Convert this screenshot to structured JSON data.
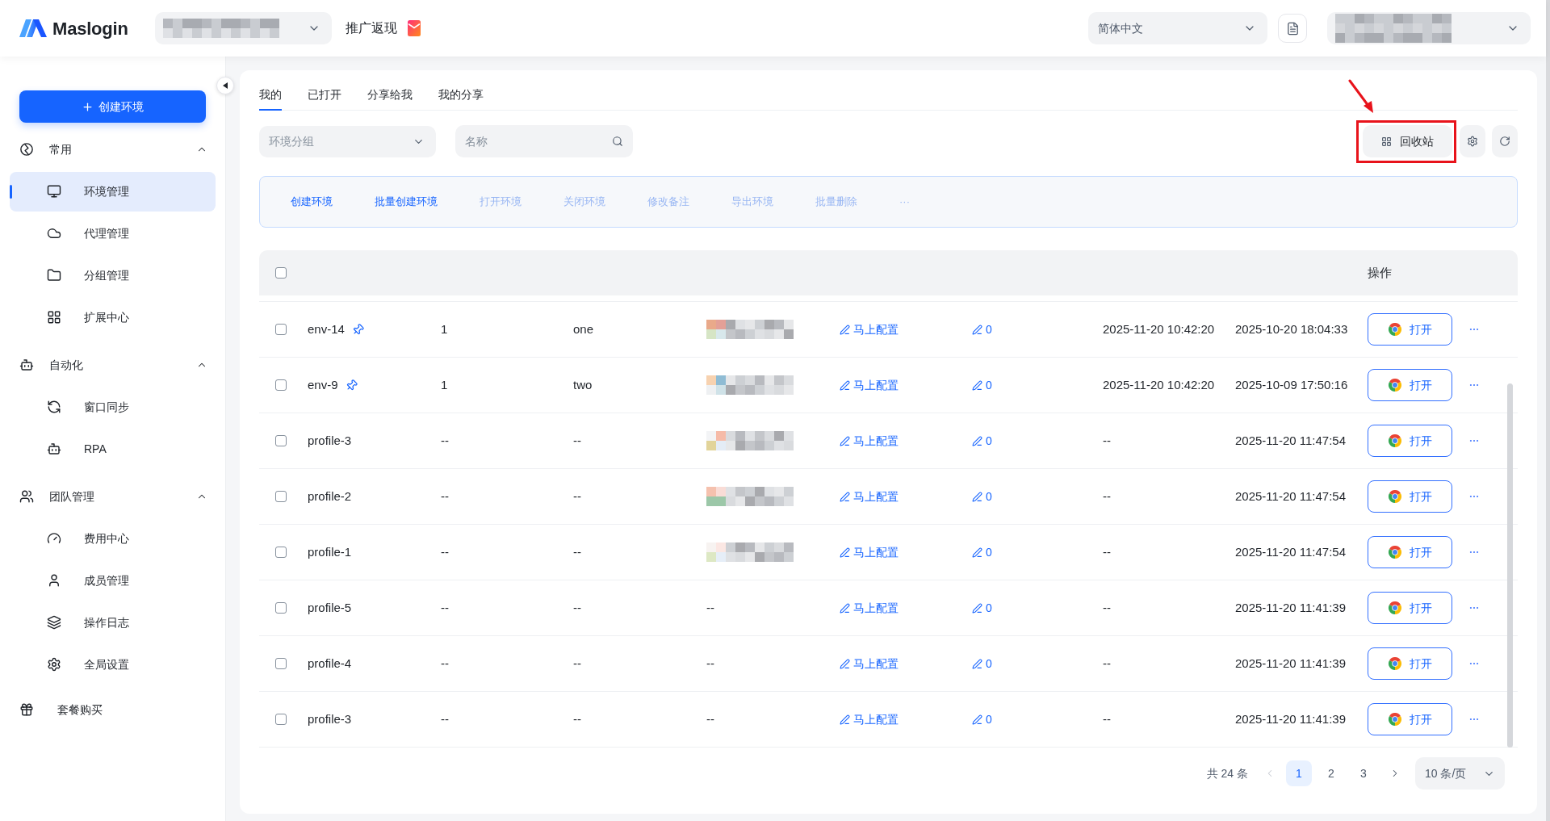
{
  "header": {
    "logo": "Maslogin",
    "workspace_select": {
      "kind": "blurred"
    },
    "promo_link": "推广返现",
    "language_select": {
      "value": "简体中文"
    },
    "account_select": {
      "kind": "blurred"
    }
  },
  "sidebar": {
    "create_button": "创建环境",
    "nav": [
      {
        "kind": "group",
        "label": "常用",
        "expanded": true,
        "children": [
          {
            "label": "环境管理",
            "selected": true
          },
          {
            "label": "代理管理",
            "selected": false
          },
          {
            "label": "分组管理",
            "selected": false
          },
          {
            "label": "扩展中心",
            "selected": false
          }
        ]
      },
      {
        "kind": "group",
        "label": "自动化",
        "expanded": true,
        "children": [
          {
            "label": "窗口同步",
            "selected": false
          },
          {
            "label": "RPA",
            "selected": false
          }
        ]
      },
      {
        "kind": "group",
        "label": "团队管理",
        "expanded": true,
        "children": [
          {
            "label": "费用中心",
            "selected": false
          },
          {
            "label": "成员管理",
            "selected": false
          },
          {
            "label": "操作日志",
            "selected": false
          },
          {
            "label": "全局设置",
            "selected": false
          }
        ]
      },
      {
        "kind": "link",
        "label": "套餐购买",
        "selected": false
      }
    ]
  },
  "tabs": [
    {
      "label": "我的",
      "selected": true
    },
    {
      "label": "已打开",
      "selected": false
    },
    {
      "label": "分享给我",
      "selected": false
    },
    {
      "label": "我的分享",
      "selected": false
    }
  ],
  "filters": {
    "group_select": {
      "placeholder": "环境分组"
    },
    "name_search": {
      "placeholder": "名称"
    }
  },
  "recycle_bin_button": "回收站",
  "highlight_annotation": {
    "kind": "frame_with_arrow"
  },
  "batch_actions": [
    {
      "label": "创建环境",
      "disabled": false
    },
    {
      "label": "批量创建环境",
      "disabled": false
    },
    {
      "label": "打开环境",
      "disabled": true
    },
    {
      "label": "关闭环境",
      "disabled": true
    },
    {
      "label": "修改备注",
      "disabled": true
    },
    {
      "label": "导出环境",
      "disabled": true
    },
    {
      "label": "批量删除",
      "disabled": true
    },
    {
      "label": "···",
      "disabled": true
    }
  ],
  "table": {
    "select_all_checked": false,
    "action_column": "操作",
    "rows": [
      {
        "checked": false,
        "name": "env-14",
        "pinned": true,
        "column_2": "1",
        "column_3": "one",
        "column_4": {
          "kind": "blurred"
        },
        "column_5": "马上配置",
        "column_6": "0",
        "column_7": "2025-11-20 10:42:20",
        "column_8": "2025-10-20 18:04:33",
        "open_button": "打开"
      },
      {
        "checked": false,
        "name": "env-9",
        "pinned": true,
        "column_2": "1",
        "column_3": "two",
        "column_4": {
          "kind": "blurred"
        },
        "column_5": "马上配置",
        "column_6": "0",
        "column_7": "2025-11-20 10:42:20",
        "column_8": "2025-10-09 17:50:16",
        "open_button": "打开"
      },
      {
        "checked": false,
        "name": "profile-3",
        "pinned": false,
        "column_2": "--",
        "column_3": "--",
        "column_4": {
          "kind": "blurred"
        },
        "column_5": "马上配置",
        "column_6": "0",
        "column_7": "--",
        "column_8": "2025-11-20 11:47:54",
        "open_button": "打开"
      },
      {
        "checked": false,
        "name": "profile-2",
        "pinned": false,
        "column_2": "--",
        "column_3": "--",
        "column_4": {
          "kind": "blurred"
        },
        "column_5": "马上配置",
        "column_6": "0",
        "column_7": "--",
        "column_8": "2025-11-20 11:47:54",
        "open_button": "打开"
      },
      {
        "checked": false,
        "name": "profile-1",
        "pinned": false,
        "column_2": "--",
        "column_3": "--",
        "column_4": {
          "kind": "blurred"
        },
        "column_5": "马上配置",
        "column_6": "0",
        "column_7": "--",
        "column_8": "2025-11-20 11:47:54",
        "open_button": "打开"
      },
      {
        "checked": false,
        "name": "profile-5",
        "pinned": false,
        "column_2": "--",
        "column_3": "--",
        "column_4": {
          "kind": "text",
          "text": "--"
        },
        "column_5": "马上配置",
        "column_6": "0",
        "column_7": "--",
        "column_8": "2025-11-20 11:41:39",
        "open_button": "打开"
      },
      {
        "checked": false,
        "name": "profile-4",
        "pinned": false,
        "column_2": "--",
        "column_3": "--",
        "column_4": {
          "kind": "text",
          "text": "--"
        },
        "column_5": "马上配置",
        "column_6": "0",
        "column_7": "--",
        "column_8": "2025-11-20 11:41:39",
        "open_button": "打开"
      },
      {
        "checked": false,
        "name": "profile-3",
        "pinned": false,
        "column_2": "--",
        "column_3": "--",
        "column_4": {
          "kind": "text",
          "text": "--"
        },
        "column_5": "马上配置",
        "column_6": "0",
        "column_7": "--",
        "column_8": "2025-11-20 11:41:39",
        "open_button": "打开"
      }
    ]
  },
  "pagination": {
    "total": "共 24 条",
    "prev": {
      "disabled": true
    },
    "pages": [
      {
        "label": "1",
        "selected": true
      },
      {
        "label": "2",
        "selected": false
      },
      {
        "label": "3",
        "selected": false
      }
    ],
    "next": {
      "disabled": false
    },
    "page_size": "10 条/页"
  }
}
